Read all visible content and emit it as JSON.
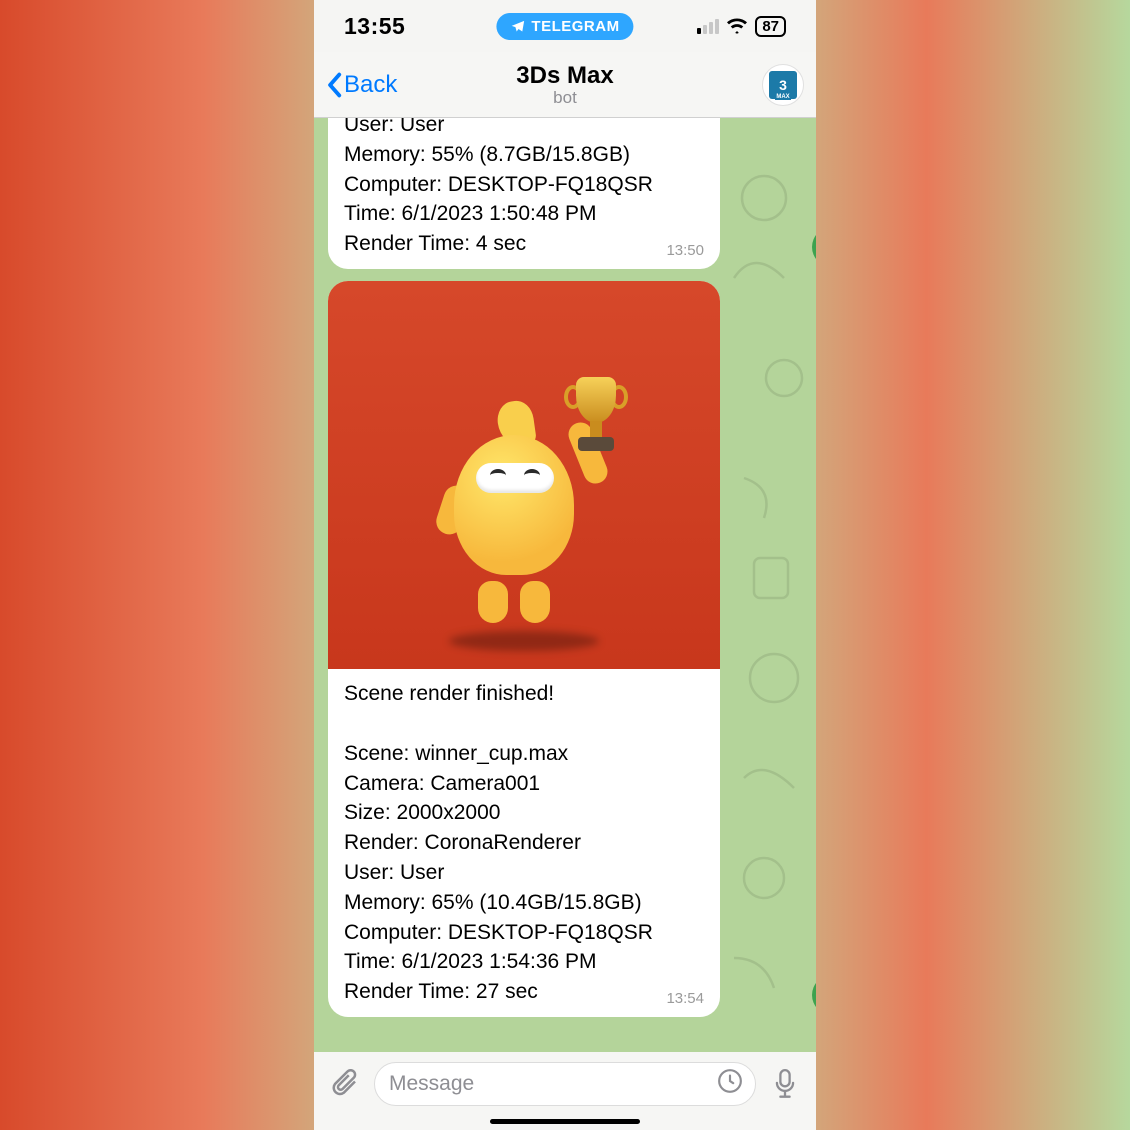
{
  "statusbar": {
    "time": "13:55",
    "battery": "87"
  },
  "pill": {
    "label": "TELEGRAM"
  },
  "nav": {
    "back": "Back",
    "title": "3Ds Max",
    "subtitle": "bot",
    "avatar_label": "3"
  },
  "msg1": {
    "lines": {
      "l1": "User: User",
      "l2": "Memory: 55% (8.7GB/15.8GB)",
      "l3": "Computer: DESKTOP-FQ18QSR",
      "l4": "Time: 6/1/2023 1:50:48 PM",
      "l5": "Render Time: 4 sec"
    },
    "time": "13:50"
  },
  "msg2": {
    "heading": "Scene render finished!",
    "lines": {
      "l1": "Scene: winner_cup.max",
      "l2": "Camera: Camera001",
      "l3": "Size: 2000x2000",
      "l4": "Render: CoronaRenderer",
      "l5": "User: User",
      "l6": "Memory: 65% (10.4GB/15.8GB)",
      "l7": "Computer: DESKTOP-FQ18QSR",
      "l8": "Time: 6/1/2023 1:54:36 PM",
      "l9": "Render Time: 27 sec"
    },
    "time": "13:54"
  },
  "input": {
    "placeholder": "Message"
  }
}
